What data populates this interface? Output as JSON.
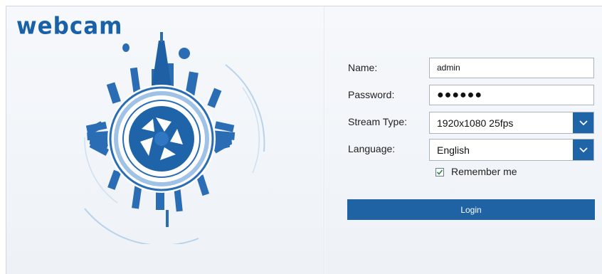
{
  "brand": {
    "logo_text": "webcam"
  },
  "form": {
    "name_label": "Name:",
    "name_value": "admin",
    "password_label": "Password:",
    "password_value": "●●●●●●",
    "stream_label": "Stream Type:",
    "stream_value": "1920x1080 25fps",
    "language_label": "Language:",
    "language_value": "English",
    "remember_label": "Remember me",
    "remember_checked": true,
    "login_label": "Login"
  },
  "colors": {
    "accent": "#1f64a6",
    "brand": "#1a62a8",
    "illustration": "#2a6db5"
  },
  "icons": {
    "dropdown": "chevron-down-icon",
    "checkbox": "checkmark-icon",
    "illustration": "camera-aperture-cityscape"
  }
}
